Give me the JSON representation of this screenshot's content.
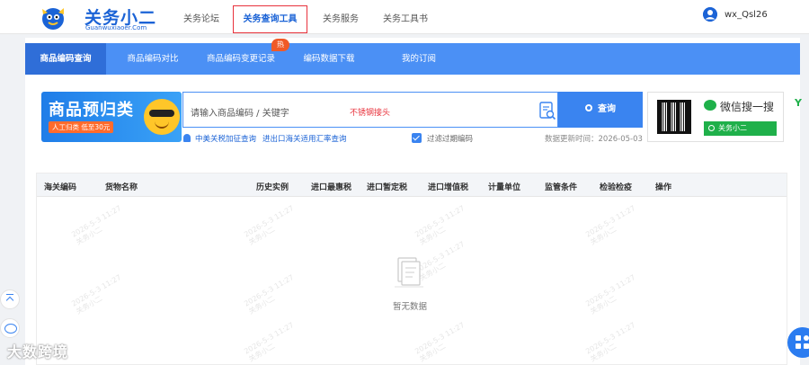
{
  "header": {
    "logo_cn": "关务小二",
    "logo_en": "Guanwuxiaoer.Com",
    "nav": [
      {
        "label": "关务论坛"
      },
      {
        "label": "关务查询工具"
      },
      {
        "label": "关务服务"
      },
      {
        "label": "关务工具书"
      }
    ],
    "user_name": "wx_Qsl26"
  },
  "subtabs": [
    {
      "label": "商品编码查询"
    },
    {
      "label": "商品编码对比"
    },
    {
      "label": "商品编码变更记录"
    },
    {
      "label": "编码数据下载"
    },
    {
      "label": "我的订阅"
    }
  ],
  "hot_badge": "热",
  "banner": {
    "title": "商品预归类",
    "sub": "人工归类 低至30元"
  },
  "search": {
    "placeholder": "请输入商品编码 / 关键字",
    "hint": "不锈钢接头",
    "button_label": "查询"
  },
  "links": {
    "link_a": "中美关税加征查询",
    "link_b": "进出口海关适用汇率查询",
    "filter_label": "过滤过期编码",
    "update_date": "数据更新时间：2026-05-03"
  },
  "qr": {
    "title": "微信搜一搜",
    "button": "关务小二"
  },
  "table": {
    "headers": [
      "海关编码",
      "货物名称",
      "历史实例",
      "进口最惠税",
      "进口暂定税",
      "进口增值税",
      "计量单位",
      "监管条件",
      "检验检疫",
      "操作"
    ],
    "empty_text": "暂无数据"
  },
  "watermark": {
    "line1": "2026-5-3 11:27",
    "line2": "关务小二"
  },
  "brand_mark": "大数跨境",
  "colors": {
    "primary": "#4b90f5",
    "active_tab": "#2f6ed8",
    "brand_blue": "#1b63d6",
    "highlight_border": "#e8323c",
    "wechat_green": "#1fb04a"
  }
}
